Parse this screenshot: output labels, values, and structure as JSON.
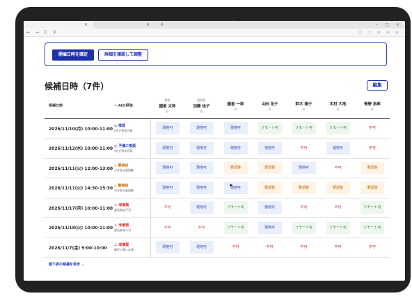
{
  "browser": {
    "tab1_label": "",
    "tab1_close": "×",
    "tab2_label": "",
    "tab2_close": "×",
    "new_tab": "+",
    "window_controls": "– □ ×",
    "nav": "← → C ⚲",
    "right_icons": "□ ○ ◎ ◎ ◎"
  },
  "actions": {
    "confirm_label": "開催日時を確定",
    "adjust_label": "詳細を確認して調整"
  },
  "section": {
    "title": "候補日時（7件）",
    "edit_label": "編集"
  },
  "table": {
    "date_header": "候補日時",
    "ai_header": "✧ AIの評価",
    "participants": [
      {
        "role": "部長",
        "name": "國者 太郎",
        "tag": "必"
      },
      {
        "role": "副部長",
        "name": "加藤 佳子",
        "tag": "必"
      },
      {
        "role": "",
        "name": "國者 一郎",
        "tag": "必"
      },
      {
        "role": "",
        "name": "山田 花子",
        "tag": "必"
      },
      {
        "role": "",
        "name": "鈴木 陽子",
        "tag": "必"
      },
      {
        "role": "",
        "name": "木村 大地",
        "tag": "必"
      },
      {
        "role": "",
        "name": "青野 拓郎",
        "tag": "必"
      }
    ],
    "rows": [
      {
        "date": "2026/11/10(月) 10:00-11:00",
        "ai": {
          "label": "◎ 推奨",
          "sub": "6名が参加可能",
          "level": "good"
        },
        "statuses": [
          "現地可",
          "現地可",
          "現地可",
          "リモート可",
          "リモート可",
          "リモート可",
          "不可"
        ]
      },
      {
        "date": "2026/11/12(水) 10:00-11:00",
        "ai": {
          "label": "◎ 予備に推奨",
          "sub": "5名が参加可能",
          "level": "good"
        },
        "statuses": [
          "現地可",
          "現地可",
          "現地可",
          "現地可",
          "不可",
          "現地可",
          "不可"
        ]
      },
      {
        "date": "2026/11/11(火) 12:00-13:00",
        "ai": {
          "label": "△ 要検討",
          "sub": "引き続き要調整",
          "level": "warn"
        },
        "statuses": [
          "現地可",
          "現地可",
          "要調整",
          "要調整",
          "現地可",
          "不可",
          "要調整"
        ]
      },
      {
        "date": "2026/11/11(火) 14:30-15:30",
        "ai": {
          "label": "△ 要検討",
          "sub": "引き続き要調整",
          "level": "warn"
        },
        "statuses": [
          "現地可",
          "現地可",
          "現地可",
          "要調整",
          "要調整",
          "要調整",
          "要調整"
        ]
      },
      {
        "date": "2026/11/17(月) 10:00-11:00",
        "ai": {
          "label": "⚠ 非推奨",
          "sub": "部長参加不可",
          "level": "bad"
        },
        "statuses": [
          "不可",
          "現地可",
          "リモート可",
          "現地可",
          "不可",
          "不可",
          "リモート可"
        ]
      },
      {
        "date": "2026/11/18(火) 10:00-11:00",
        "ai": {
          "label": "⚠ 非推奨",
          "sub": "部長参加不可",
          "level": "bad"
        },
        "statuses": [
          "不可",
          "不可",
          "リモート可",
          "現地可",
          "リモート可",
          "リモート可",
          "リモート可"
        ]
      },
      {
        "date": "2026/11/7(金) 9:00-10:00",
        "ai": {
          "label": "⚠ 非推奨",
          "sub": "複代人数に未達",
          "level": "bad"
        },
        "statuses": [
          "現地可",
          "現地可",
          "不可",
          "不可",
          "不可",
          "不可",
          "不可"
        ]
      }
    ]
  },
  "footer": {
    "more_label": "部下表の候補を表示 ⌄"
  },
  "colors": {
    "primary": "#1e31a8",
    "ok_bg": "#e9effb",
    "remote_bg": "#edf7ee",
    "adjust_bg": "#fdf3e6",
    "ng_text": "#d02525"
  }
}
